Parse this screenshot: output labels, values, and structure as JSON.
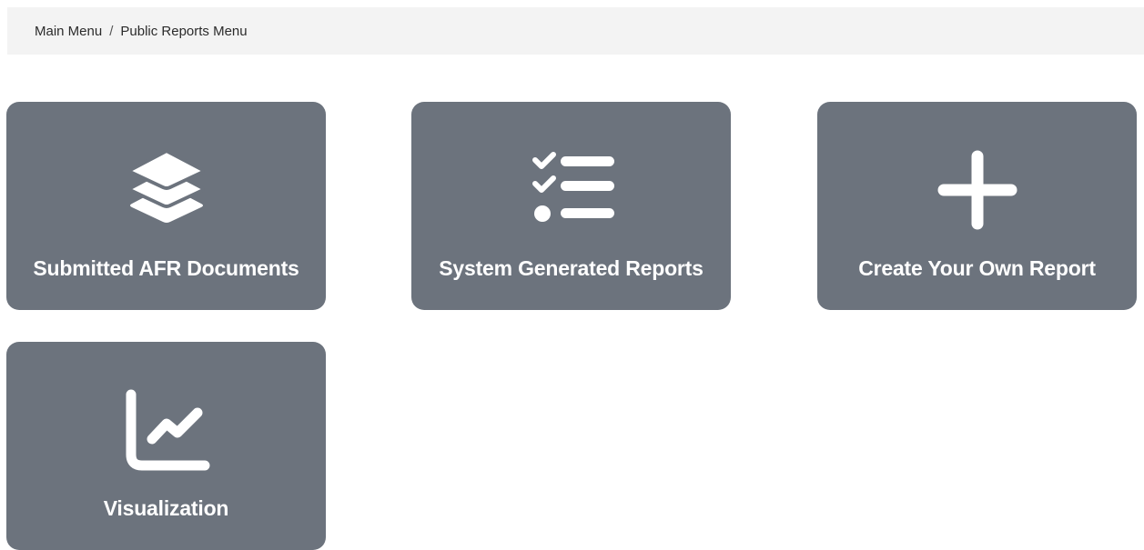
{
  "breadcrumb": {
    "items": [
      {
        "label": "Main Menu"
      },
      {
        "label": "Public Reports Menu"
      }
    ],
    "separator": "/"
  },
  "tiles": [
    {
      "label": "Submitted AFR Documents",
      "icon": "layers-icon"
    },
    {
      "label": "System Generated Reports",
      "icon": "checklist-icon"
    },
    {
      "label": "Create Your Own Report",
      "icon": "plus-icon"
    },
    {
      "label": "Visualization",
      "icon": "line-chart-icon"
    }
  ],
  "colors": {
    "tile_background": "#6c737d",
    "tile_text": "#ffffff",
    "breadcrumb_background": "#f3f3f3"
  }
}
